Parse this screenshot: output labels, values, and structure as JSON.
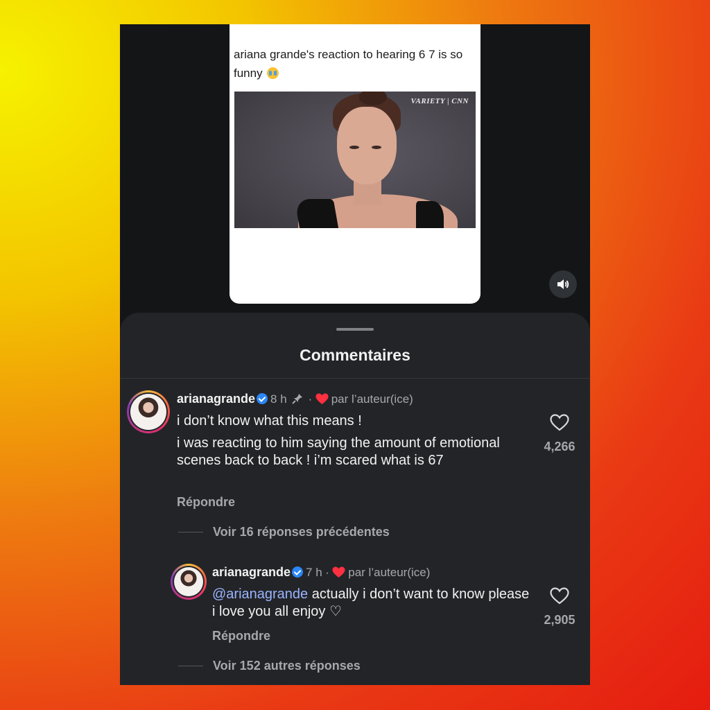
{
  "post": {
    "text": "ariana grande's reaction to hearing 6 7 is so funny",
    "emoji": "loudly-crying-face-icon",
    "video_watermark": "VARIETY | CNN"
  },
  "comments_sheet": {
    "title": "Commentaires"
  },
  "comments": [
    {
      "username": "ariana grande",
      "username_display": "arianagrande",
      "verified": true,
      "time": "8 h",
      "pinned": true,
      "liked_by_author": "par l’auteur(ice)",
      "paragraphs": [
        "i don’t know what this means !",
        "i was reacting to him saying the amount of emotional scenes back to back ! i’m scared what is 67"
      ],
      "reply_label": "Répondre",
      "like_count": "4,266"
    }
  ],
  "view_previous_label": "Voir 16 réponses précédentes",
  "reply": {
    "username_display": "arianagrande",
    "verified": true,
    "time": "7 h",
    "liked_by_author": "par l’auteur(ice)",
    "mention": "@arianagrande",
    "text": " actually i don’t want to know please i love you all enjoy ♡",
    "reply_label": "Répondre",
    "like_count": "2,905"
  },
  "view_more_label": "Voir 152 autres réponses",
  "colors": {
    "sheet_bg": "#232428",
    "verified_blue": "#2b86f6",
    "heart_red": "#ff3040",
    "mention_blue": "#9ab5ff"
  }
}
